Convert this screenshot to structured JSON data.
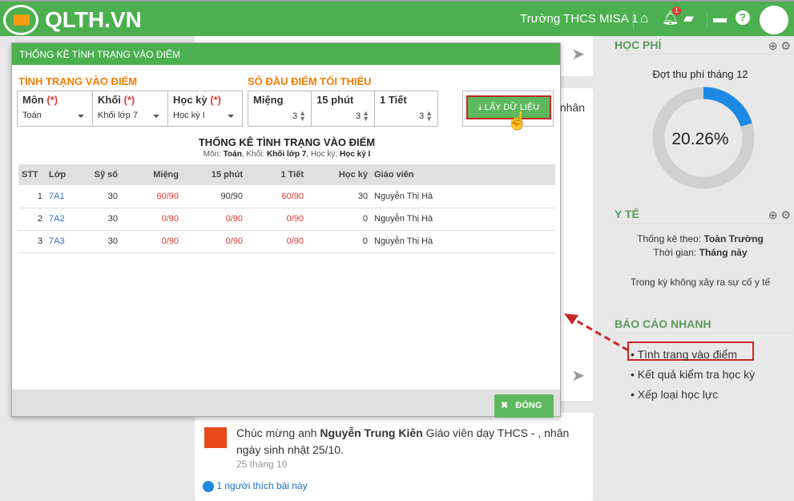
{
  "header": {
    "logo": "QLTH.VN",
    "school": "Trường THCS MISA 1",
    "notif_count": "1"
  },
  "right": {
    "hocphi": {
      "title": "HỌC PHÍ",
      "subtitle": "Đợt thu phí tháng 12",
      "percent_label": "20.26%",
      "percent": 20.26
    },
    "yte": {
      "title": "Y TẾ",
      "stat_by_label": "Thống kê theo:",
      "stat_by": "Toàn Trường",
      "time_label": "Thời gian:",
      "time": "Tháng này",
      "message": "Trong kỳ không xảy ra sự cố y tế"
    },
    "baocao": {
      "title": "BÁO CÁO NHANH",
      "items": [
        "Tình trạng vào điểm",
        "Kết quả kiểm tra học kỳ",
        "Xếp loại học lực"
      ]
    }
  },
  "feed": {
    "partial_text": "nhân",
    "post": {
      "pre": "Chúc mừng anh",
      "name": "Nguyễn Trung Kiên",
      "post": "Giáo viên dạy THCS - , nhân ngày sinh nhật 25/10.",
      "date": "25 tháng 10",
      "likes": "1 người thích bài này"
    }
  },
  "modal": {
    "title": "THỐNG KÊ TÌNH TRẠNG VÀO ĐIỂM",
    "section1": "TÌNH TRẠNG VÀO ĐIỂM",
    "section2": "SỐ ĐẦU ĐIỂM TỐI THIỂU",
    "req": "(*)",
    "filters": {
      "mon_label": "Môn",
      "mon": "Toán",
      "khoi_label": "Khối",
      "khoi": "Khối lớp 7",
      "hocky_label": "Học kỳ",
      "hocky": "Học kỳ I"
    },
    "min": {
      "mieng_label": "Miệng",
      "mieng": "3",
      "p15_label": "15 phút",
      "p15": "3",
      "tiet_label": "1 Tiết",
      "tiet": "3"
    },
    "get_button": "LẤY DỮ LIỆU",
    "table_title": "THỐNG KÊ TÌNH TRẠNG VÀO ĐIỂM",
    "sub": {
      "mon_l": "Môn:",
      "mon": "Toán",
      "khoi_l": ", Khối:",
      "khoi": "Khối lớp 7",
      "hk_l": ", Học kỳ:",
      "hk": "Học kỳ I"
    },
    "columns": [
      "STT",
      "Lớp",
      "Sỹ số",
      "Miệng",
      "15 phút",
      "1 Tiết",
      "Học kỳ",
      "Giáo viên"
    ],
    "rows": [
      [
        "1",
        "7A1",
        "30",
        "60/90",
        "90/90",
        "60/90",
        "30",
        "Nguyễn Thị Hà"
      ],
      [
        "2",
        "7A2",
        "30",
        "0/90",
        "0/90",
        "0/90",
        "0",
        "Nguyễn Thị Hà"
      ],
      [
        "3",
        "7A3",
        "30",
        "0/90",
        "0/90",
        "0/90",
        "0",
        "Nguyễn Thị Hà"
      ]
    ],
    "close": "ĐÓNG"
  },
  "colors": {
    "green": "#4caf50",
    "orange": "#f57c00",
    "red": "#e53935",
    "blue": "#1e88e5"
  }
}
